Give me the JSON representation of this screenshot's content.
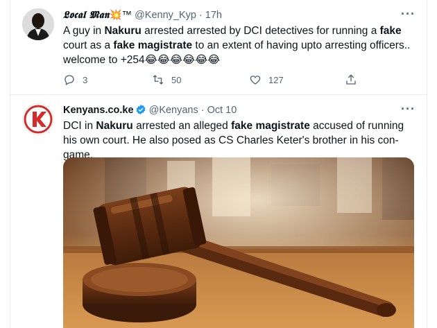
{
  "tweet1": {
    "display_name": "𝕷𝖔𝖈𝖆𝖑 𝕸𝖆𝖓",
    "name_suffix": "💥™",
    "handle": "@Kenny_Kyp",
    "time": "17h",
    "text_parts": [
      "A guy in ",
      "Nakuru",
      " arrested arrested by DCI detectives for running a ",
      "fake",
      " court as a ",
      "fake magistrate",
      " to an extent of having upto arresting officers.. welcome to +254",
      "😂😂😂😂😂😂"
    ],
    "replies": "3",
    "retweets": "50",
    "likes": "127"
  },
  "tweet2": {
    "display_name": "Kenyans.co.ke",
    "handle": "@Kenyans",
    "time": "Oct 10",
    "logo_letter": "K",
    "text_parts": [
      "DCI in ",
      "Nakuru",
      " arrested an alleged ",
      "fake magistrate",
      " accused of running his own court. He also posed as CS Charles Keter's brother in his con-game."
    ]
  },
  "icons": {
    "more": "more-horizontal-icon",
    "reply": "reply-icon",
    "retweet": "retweet-icon",
    "like": "heart-icon",
    "share": "share-icon",
    "verified": "verified-badge-icon"
  },
  "colors": {
    "text": "#0f1419",
    "secondary": "#536471",
    "verified": "#1d9bf0",
    "logo_red": "#d62b2b"
  }
}
